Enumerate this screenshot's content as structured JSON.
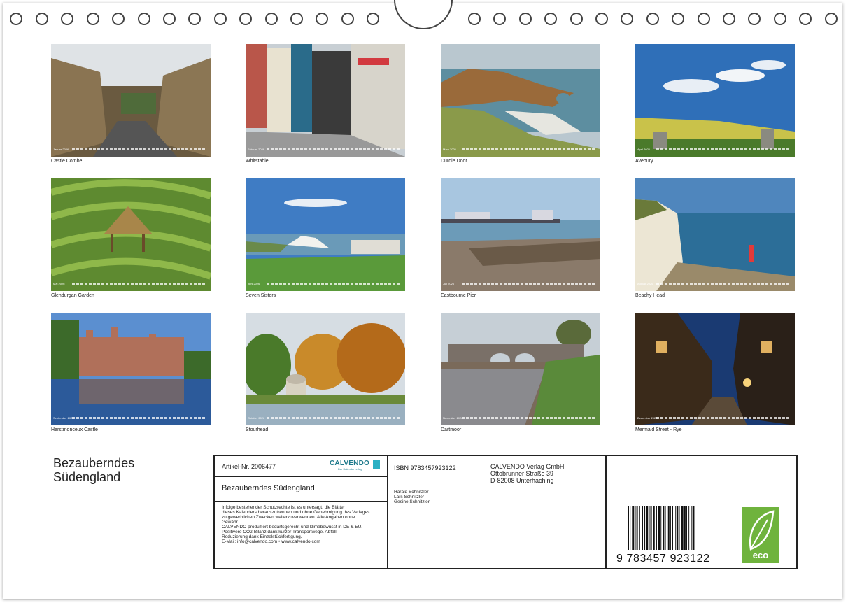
{
  "photos": [
    {
      "caption": "Castle Combe",
      "month": "Januar 2026"
    },
    {
      "caption": "Whitstable",
      "month": "Februar 2026"
    },
    {
      "caption": "Durdle Door",
      "month": "März 2026"
    },
    {
      "caption": "Avebury",
      "month": "April 2026"
    },
    {
      "caption": "Glendurgan Garden",
      "month": "Mai 2026"
    },
    {
      "caption": "Seven Sisters",
      "month": "Juni 2026"
    },
    {
      "caption": "Eastbourne Pier",
      "month": "Juli 2026"
    },
    {
      "caption": "Beachy Head",
      "month": "August 2026"
    },
    {
      "caption": "Herstmonceux Castle",
      "month": "September 2026"
    },
    {
      "caption": "Stourhead",
      "month": "Oktober 2026"
    },
    {
      "caption": "Dartmoor",
      "month": "November 2026"
    },
    {
      "caption": "Mermaid Street - Rye",
      "month": "Dezember 2026"
    }
  ],
  "title_line1": "Bezauberndes",
  "title_line2": "Südengland",
  "info": {
    "article": "Artikel-Nr. 2006477",
    "calendar_title": "Bezauberndes Südengland",
    "isbn": "ISBN 9783457923122",
    "publisher_name": "CALVENDO Verlag GmbH",
    "publisher_street": "Ottobrunner Straße 39",
    "publisher_city": "D-82008 Unterhaching",
    "author1": "Harald Schnitzler",
    "author2": "Lars Schnitzler",
    "author3": "Gesine Schnitzler",
    "legal1": "Infolge bestehender Schutzrechte ist es untersagt, die Blätter",
    "legal2": "dieses Kalenders herauszutrennen und ohne Genehmigung des Verlages",
    "legal3": "zu gewerblichen Zwecken weiterzuverwenden. Alle Angaben ohne",
    "legal4": "Gewähr.",
    "legal5": "CALVENDO produziert bedarfsgerecht und klimabewusst in DE & EU.",
    "legal6": "Positivere CO2-Bilanz dank kurzer Transportwege. Abfall-",
    "legal7": "Reduzierung dank Einzelstückfertigung.",
    "legal8": "E-Mail: info@calvendo.com • www.calvendo.com",
    "calvendo_logo": "CALVENDO",
    "calvendo_tag": "Der Kalenderverlag",
    "barcode_number": "9 783457 923122",
    "eco_label": "eco"
  }
}
